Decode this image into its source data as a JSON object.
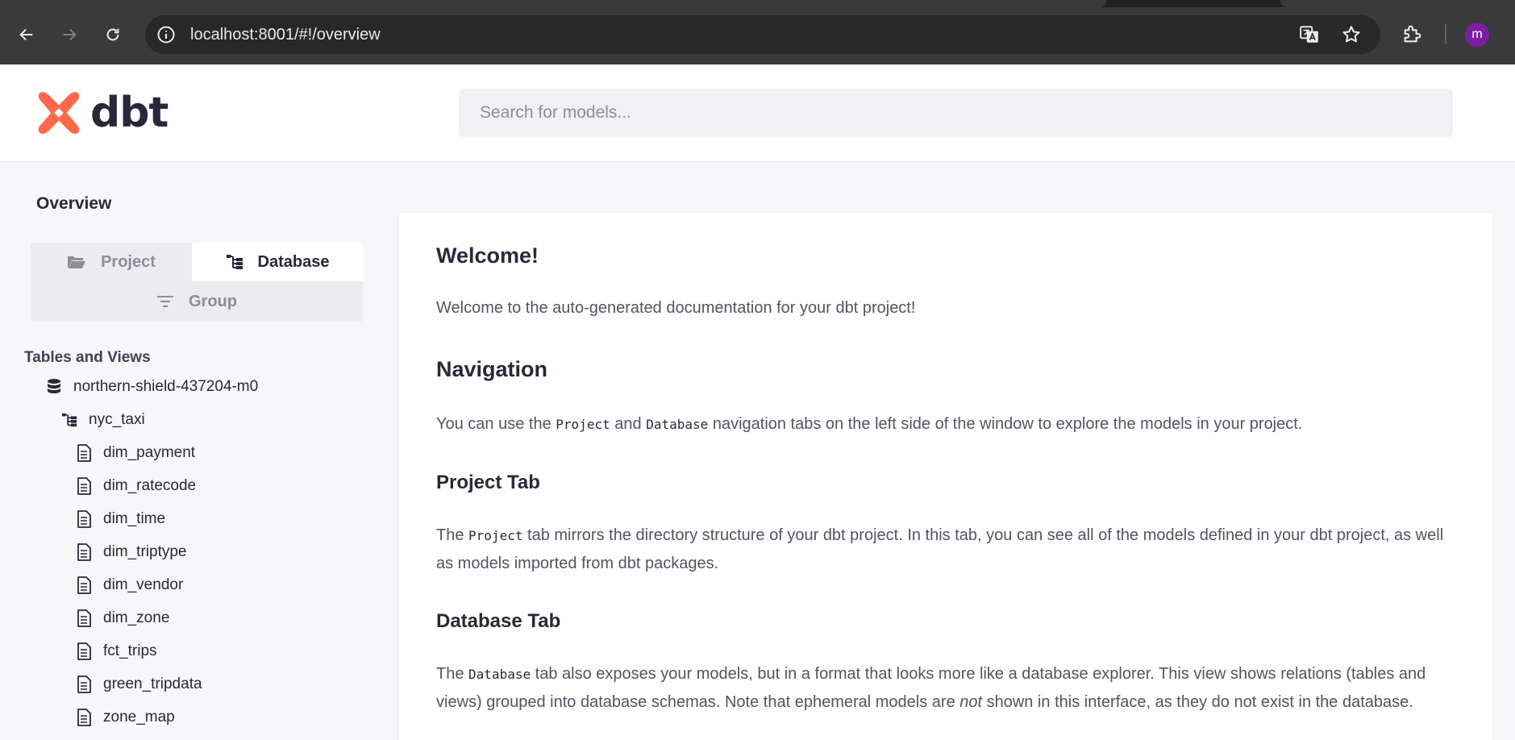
{
  "browser": {
    "url": "localhost:8001/#!/overview",
    "avatar_letter": "m",
    "avatar_color": "#7b1fa2"
  },
  "header": {
    "logo_text": "dbt",
    "brand_color": "#ff694a",
    "search_placeholder": "Search for models..."
  },
  "sidebar": {
    "title": "Overview",
    "tabs": {
      "project": "Project",
      "database": "Database",
      "group": "Group"
    },
    "section_title": "Tables and Views",
    "database_name": "northern-shield-437204-m0",
    "schema_name": "nyc_taxi",
    "models": [
      "dim_payment",
      "dim_ratecode",
      "dim_time",
      "dim_triptype",
      "dim_vendor",
      "dim_zone",
      "fct_trips",
      "green_tripdata",
      "zone_map"
    ]
  },
  "main": {
    "welcome_title": "Welcome!",
    "welcome_text": "Welcome to the auto-generated documentation for your dbt project!",
    "nav_title": "Navigation",
    "nav_text": {
      "part1": "You can use the ",
      "code1": "Project",
      "part2": " and ",
      "code2": "Database",
      "part3": " navigation tabs on the left side of the window to explore the models in your project."
    },
    "project_tab_title": "Project Tab",
    "project_tab_text": {
      "part1": "The ",
      "code1": "Project",
      "part2": " tab mirrors the directory structure of your dbt project. In this tab, you can see all of the models defined in your dbt project, as well as models imported from dbt packages."
    },
    "database_tab_title": "Database Tab",
    "database_tab_text": {
      "part1": "The ",
      "code1": "Database",
      "part2": " tab also exposes your models, but in a format that looks more like a database explorer. This view shows relations (tables and views) grouped into database schemas. Note that ephemeral models are ",
      "emphasis": "not",
      "part3": " shown in this interface, as they do not exist in the database."
    }
  }
}
